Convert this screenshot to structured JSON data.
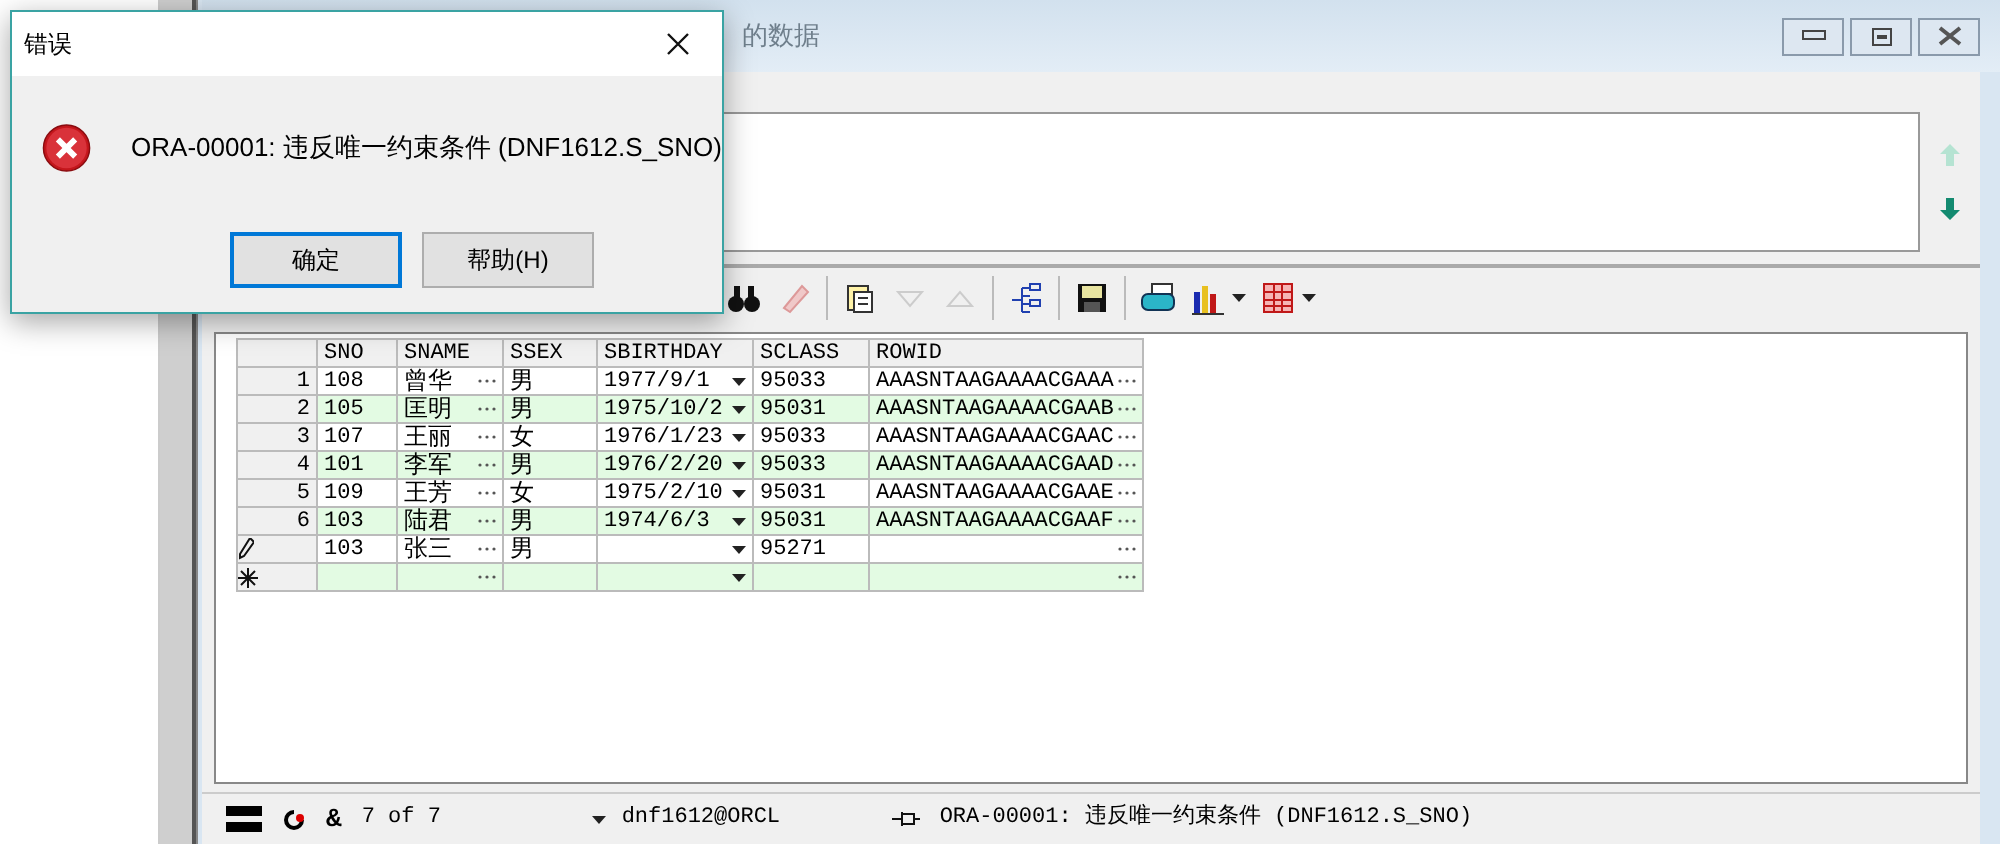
{
  "window": {
    "title": "的数据"
  },
  "grid": {
    "columns": [
      {
        "label": "SNO",
        "kind": "plain"
      },
      {
        "label": "SNAME",
        "kind": "ellipsis"
      },
      {
        "label": "SSEX",
        "kind": "plain"
      },
      {
        "label": "SBIRTHDAY",
        "kind": "dropdown"
      },
      {
        "label": "SCLASS",
        "kind": "plain"
      },
      {
        "label": "ROWID",
        "kind": "ellipsis"
      }
    ],
    "rows": [
      {
        "kind": "data",
        "number": "1",
        "cells": [
          "108",
          "曾华",
          "男",
          "1977/9/1",
          "95033",
          "AAASNTAAGAAAACGAAA"
        ]
      },
      {
        "kind": "data",
        "number": "2",
        "cells": [
          "105",
          "匡明",
          "男",
          "1975/10/2",
          "95031",
          "AAASNTAAGAAAACGAAB"
        ]
      },
      {
        "kind": "data",
        "number": "3",
        "cells": [
          "107",
          "王丽",
          "女",
          "1976/1/23",
          "95033",
          "AAASNTAAGAAAACGAAC"
        ]
      },
      {
        "kind": "data",
        "number": "4",
        "cells": [
          "101",
          "李军",
          "男",
          "1976/2/20",
          "95033",
          "AAASNTAAGAAAACGAAD"
        ]
      },
      {
        "kind": "data",
        "number": "5",
        "cells": [
          "109",
          "王芳",
          "女",
          "1975/2/10",
          "95031",
          "AAASNTAAGAAAACGAAE"
        ]
      },
      {
        "kind": "data",
        "number": "6",
        "cells": [
          "103",
          "陆君",
          "男",
          "1974/6/3",
          "95031",
          "AAASNTAAGAAAACGAAF"
        ]
      },
      {
        "kind": "editing",
        "cells": [
          "103",
          "张三",
          "男",
          "",
          "95271",
          ""
        ]
      },
      {
        "kind": "new",
        "cells": [
          "",
          "",
          "",
          "",
          "",
          ""
        ]
      }
    ]
  },
  "status_bar": {
    "symbol": "&",
    "record": "7 of 7",
    "connection": "dnf1612@ORCL",
    "message": "ORA-00001: 违反唯一约束条件 (DNF1612.S_SNO)"
  },
  "dialog": {
    "title": "错误",
    "message": "ORA-00001: 违反唯一约束条件 (DNF1612.S_SNO)",
    "buttons": [
      {
        "label": "确定",
        "focused": true
      },
      {
        "label": "帮助(H)",
        "focused": false
      }
    ]
  }
}
